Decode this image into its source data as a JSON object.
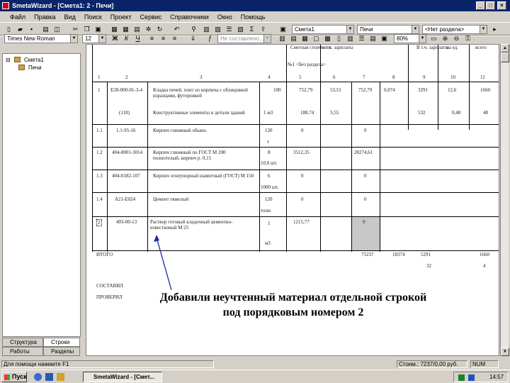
{
  "window": {
    "title": "SmetaWizard - [Смета1: 2 - Печи]",
    "min": "_",
    "max": "□",
    "close": "×"
  },
  "menu": [
    "Файл",
    "Правка",
    "Вид",
    "Поиск",
    "Проект",
    "Сервис",
    "Справочники",
    "Окно",
    "Помощь"
  ],
  "toolbar1": {
    "estimate_combo": "Смета1",
    "section_combo": "Печи",
    "subsection_combo": "<Нет раздела>"
  },
  "toolbar2": {
    "font_combo": "Times New Roman",
    "size_combo": "12",
    "bold": "Ж",
    "italic": "К",
    "underline": "Ч",
    "style_combo": "Не составлено...",
    "zoom_combo": "80%"
  },
  "tree": {
    "root": "Смета1",
    "child": "Печи",
    "expander": "⊟"
  },
  "tabs": {
    "structure": "Структура",
    "rows": "Строки",
    "works": "Работы",
    "sections": "Разделы"
  },
  "doc": {
    "header_cells": [
      "Сметная стоимость",
      "в т.ч. зарплаты",
      "",
      "В т.ч. зарплаты",
      "на ед.",
      "всего"
    ],
    "section_title": "№1 <Без раздела>",
    "col_numbers": [
      "1",
      "2",
      "3",
      "4",
      "5",
      "6",
      "7",
      "8",
      "9",
      "10",
      "11"
    ],
    "rows": [
      {
        "n": "1",
        "code": "Е28-000-01-3-4",
        "name": "Кладка печей, плит из кирпича с облицовкой изразцами, футеровкой",
        "qty": "100",
        "price": "752,79",
        "zp": "53,51",
        "total": "752,79",
        "e": "0,074",
        "f": "3291",
        "g": "12,6",
        "h": "1660"
      },
      {
        "code": "(118)",
        "name": "Конструктивные элементы и детали зданий",
        "qty": "1 м3",
        "price": "188,74",
        "zp": "3,55",
        "f": "532",
        "g": "0,48",
        "h": "48"
      },
      {
        "n": "1.1",
        "code": "1.1-95-16",
        "name": "Кирпич глиняный обыкн.",
        "qty": "120",
        "qty2": "т",
        "price": "0",
        "total": "0"
      },
      {
        "n": "1.2",
        "code": "404-8001-3014",
        "name": "Кирпич глиняный по ГОСТ М 200 полнотелый, кирпич р. 0,15",
        "qty": "8",
        "qty2": "10,0 шт.",
        "price": "3512,35",
        "total": "28274,61"
      },
      {
        "n": "1.3",
        "code": "404-0182-107",
        "name": "Кирпич огнеупорный шамотный (ГОСТ) М 150",
        "qty": "6",
        "qty2": "1000 шт.",
        "price": "0",
        "total": "0"
      },
      {
        "n": "1.4",
        "code": "А21-Е024",
        "name": "Цемент тяжелый",
        "qty": "120",
        "qty2": "тонн",
        "price": "0",
        "total": "0"
      },
      {
        "n": "2",
        "code": "403-00-13",
        "name": "Раствор готовый кладочный цементно-известковый М 25",
        "qty": "1",
        "qty2": "м3",
        "price": "1215,77",
        "total": "0"
      }
    ],
    "total_label": "ИТОГО",
    "totals": {
      "a": "75237",
      "b": "18374",
      "c": "5291",
      "d": "1660",
      "e": "32",
      "f": "4"
    },
    "signature_1": "СОСТАВИЛ",
    "signature_2": "ПРОВЕРИЛ",
    "annotation_line1": "Добавили неучтенный материал отдельной строкой",
    "annotation_line2": "под порядковым номером 2"
  },
  "status": {
    "help": "Для помощи нажмите F1",
    "cost": "Стоим.: 7237/0,00 руб.",
    "mode": "NUM"
  },
  "taskbar": {
    "start": "Пуск",
    "task": "SmetaWizard - [Смет...",
    "time": "14:57"
  }
}
